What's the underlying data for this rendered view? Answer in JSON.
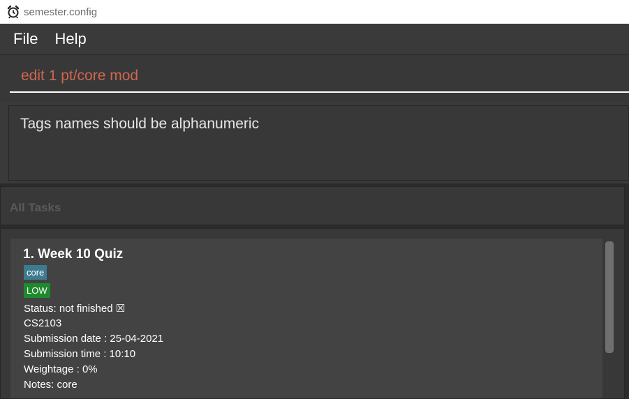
{
  "window": {
    "title": "semester.config",
    "icon": "alarm-clock-icon"
  },
  "menu": {
    "items": [
      "File",
      "Help"
    ]
  },
  "command": {
    "value": "edit 1 pt/core mod"
  },
  "result": {
    "message": "Tags names should be alphanumeric"
  },
  "list": {
    "header": "All Tasks",
    "tasks": [
      {
        "index_title": "1.  Week 10 Quiz",
        "tag": "core",
        "priority": "LOW",
        "status": "Status: not finished ☒",
        "module": "CS2103",
        "submission_date": "Submission date : 25-04-2021",
        "submission_time": "Submission time : 10:10",
        "weightage": "Weightage : 0%",
        "notes": "Notes: core"
      }
    ]
  },
  "colors": {
    "command_text": "#d06651",
    "tag_core": "#3e7b91",
    "tag_low": "#1d8a2e",
    "background": "#2b2b2b"
  }
}
